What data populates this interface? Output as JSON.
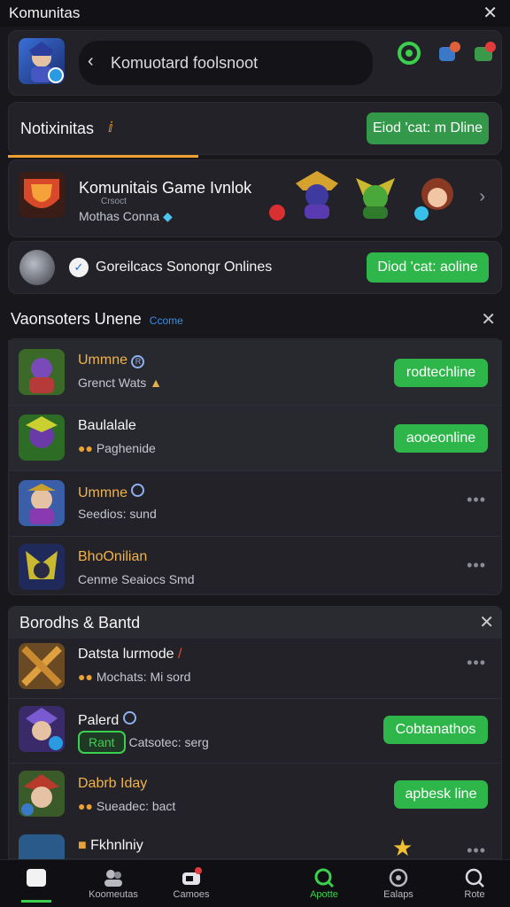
{
  "topbar": {
    "title": "Komunitas"
  },
  "search": {
    "text": "Komuotard foolsnoot"
  },
  "notif": {
    "title": "Notixinitas",
    "button": "Eiod 'cat: m Dline"
  },
  "community": {
    "title": "Komunitais Game Ivnlok",
    "small": "Crsoct",
    "sub": "Mothas Conna"
  },
  "online_banner": {
    "text": "Goreilcacs Sonongr Onlines",
    "button": "Diod 'cat: aoline"
  },
  "section1": {
    "title": "Vaonsoters Unene",
    "tag": "Ccome"
  },
  "rows1": [
    {
      "name": "Ummne",
      "sub": "Grenct Wats",
      "button": "rodtechline"
    },
    {
      "name": "Baulalale",
      "sub": "Paghenide",
      "button": "aooeonline"
    },
    {
      "name": "Ummne",
      "sub": "Seedios:  sund"
    },
    {
      "name": "BhoOnilian",
      "sub": "Cenme Seaiocs  Smd"
    }
  ],
  "section2": {
    "title": "Borodhs & Bantd"
  },
  "rows2": [
    {
      "name": "Datsta lurmode",
      "sub": "Mochats: Mi sord"
    },
    {
      "name": "Palerd",
      "pill": "Rant",
      "sub": "Catsotec:  serg",
      "button": "Cobtanathos"
    },
    {
      "name": "Dabrb Iday",
      "sub": "Sueadec:  bact",
      "button": "apbesk line"
    },
    {
      "name": "Fkhnlniy",
      "sub": ""
    }
  ],
  "nav": [
    {
      "label": ""
    },
    {
      "label": "Koomeutas"
    },
    {
      "label": "Camoes"
    },
    {
      "label": "Apotte"
    },
    {
      "label": "Ealaps"
    },
    {
      "label": "Rote"
    }
  ],
  "colors": {
    "accent_green": "#2fb64a",
    "bg": "#17171c",
    "card": "#222228",
    "gold": "#f1b34a",
    "orange_underline": "#f0a030"
  }
}
